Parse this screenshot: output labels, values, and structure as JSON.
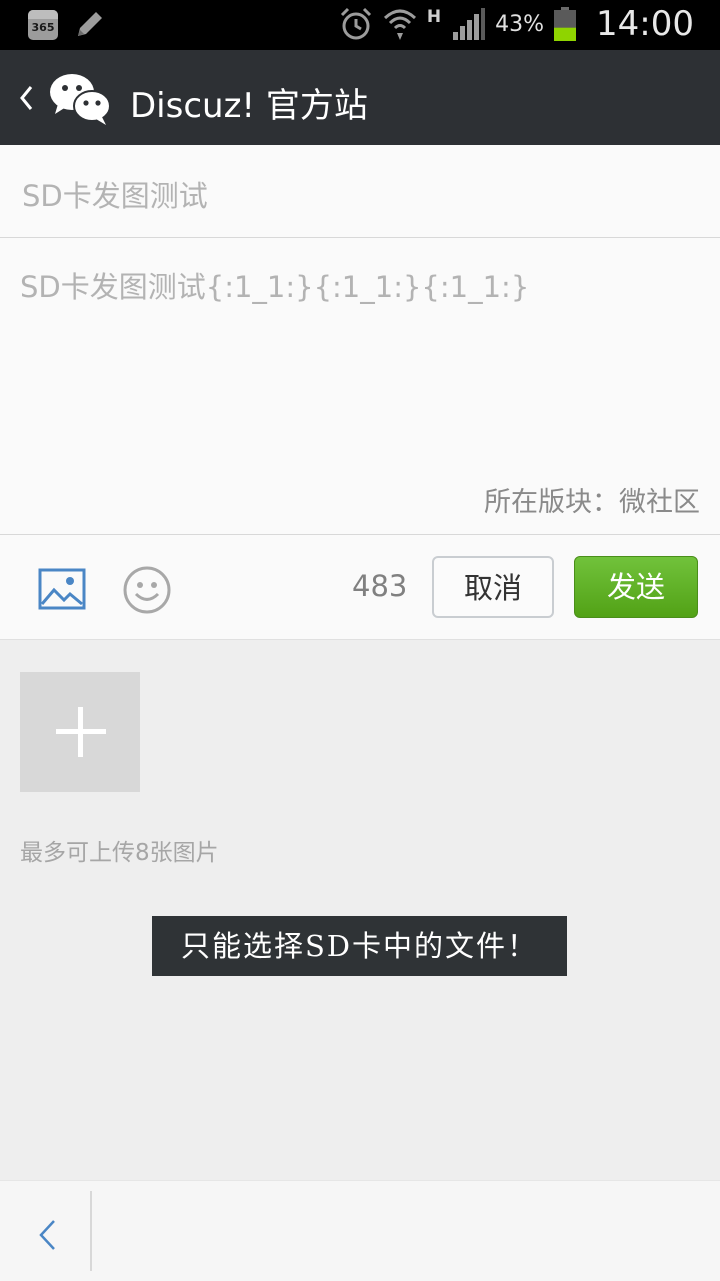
{
  "status_bar": {
    "calendar_day": "365",
    "network_type": "H",
    "battery_percent": "43%",
    "battery_level": 0.43,
    "time": "14:00",
    "icons": [
      "calendar-icon",
      "pencil-icon",
      "alarm-icon",
      "wifi-icon",
      "signal-icon",
      "battery-icon"
    ]
  },
  "header": {
    "title": "Discuz! 官方站"
  },
  "post": {
    "subject": "SD卡发图测试",
    "content": "SD卡发图测试{:1_1:}{:1_1:}{:1_1:}",
    "forum_label": "所在版块：微社区"
  },
  "toolbar": {
    "char_count": "483",
    "cancel_label": "取消",
    "send_label": "发送"
  },
  "attachments": {
    "hint": "最多可上传8张图片"
  },
  "toast": {
    "message": "只能选择SD卡中的文件！"
  },
  "colors": {
    "title_bar": "#2d3034",
    "send_green": "#5aad1f",
    "toast_bg": "#2f3336"
  }
}
